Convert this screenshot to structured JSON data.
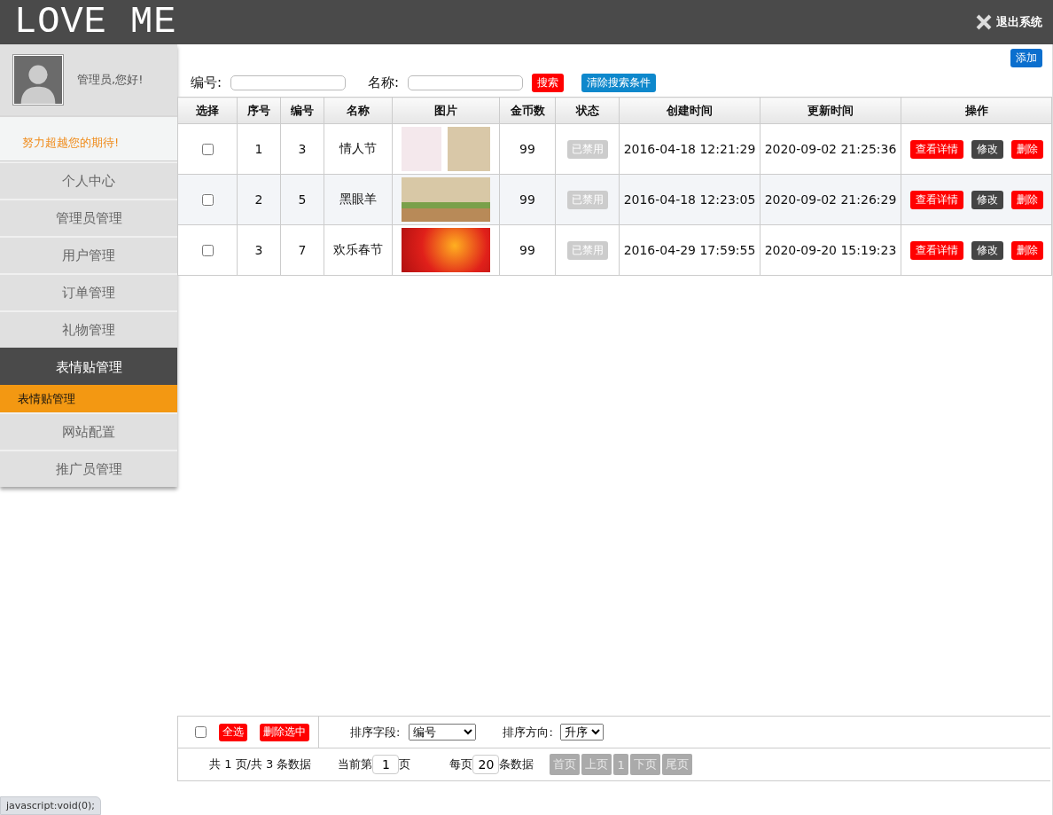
{
  "header": {
    "logo": "LOVE ME",
    "logout": "退出系统"
  },
  "sidebar": {
    "greeting": "管理员,您好!",
    "slogan": "努力超越您的期待!",
    "menu": [
      {
        "label": "个人中心",
        "selected": false
      },
      {
        "label": "管理员管理",
        "selected": false
      },
      {
        "label": "用户管理",
        "selected": false
      },
      {
        "label": "订单管理",
        "selected": false
      },
      {
        "label": "礼物管理",
        "selected": false
      },
      {
        "label": "表情贴管理",
        "selected": true,
        "children": [
          {
            "label": "表情贴管理",
            "selected": true
          }
        ]
      },
      {
        "label": "网站配置",
        "selected": false
      },
      {
        "label": "推广员管理",
        "selected": false
      }
    ]
  },
  "toolbar": {
    "add": "添加",
    "fields": [
      {
        "label": "编号:"
      },
      {
        "label": "名称:"
      }
    ],
    "search": "搜索",
    "clear": "清除搜索条件"
  },
  "table": {
    "columns": [
      "选择",
      "序号",
      "编号",
      "名称",
      "图片",
      "金币数",
      "状态",
      "创建时间",
      "更新时间",
      "操作"
    ],
    "rows": [
      {
        "checked": false,
        "seq": "1",
        "code": "3",
        "name": "情人节",
        "coins": "99",
        "status": "已禁用",
        "created": "2016-04-18 12:21:29",
        "updated": "2020-09-02 21:25:36",
        "actions": [
          "查看详情",
          "修改",
          "删除"
        ]
      },
      {
        "checked": false,
        "seq": "2",
        "code": "5",
        "name": "黑眼羊",
        "coins": "99",
        "status": "已禁用",
        "created": "2016-04-18 12:23:05",
        "updated": "2020-09-02 21:26:29",
        "actions": [
          "查看详情",
          "修改",
          "删除"
        ]
      },
      {
        "checked": false,
        "seq": "3",
        "code": "7",
        "name": "欢乐春节",
        "coins": "99",
        "status": "已禁用",
        "created": "2016-04-29 17:59:55",
        "updated": "2020-09-20 15:19:23",
        "actions": [
          "查看详情",
          "修改",
          "删除"
        ]
      }
    ]
  },
  "footer": {
    "select_all_checked": false,
    "select_all": "全选",
    "delete_selected": "删除选中",
    "sort_field_label": "排序字段:",
    "sort_field": "编号",
    "sort_dir_label": "排序方向:",
    "sort_dir": "升序",
    "summary": "共 1 页/共 3 条数据",
    "current_prefix": "当前第",
    "current_page": "1",
    "current_suffix": "页",
    "per_prefix": "每页",
    "per_page": "20",
    "per_suffix": "条数据",
    "pager": [
      {
        "label": "首页",
        "disabled": true
      },
      {
        "label": "上页",
        "disabled": true
      },
      {
        "label": "1",
        "disabled": true
      },
      {
        "label": "下页",
        "disabled": true
      },
      {
        "label": "尾页",
        "disabled": true
      }
    ]
  },
  "status_bar": "javascript:void(0);"
}
